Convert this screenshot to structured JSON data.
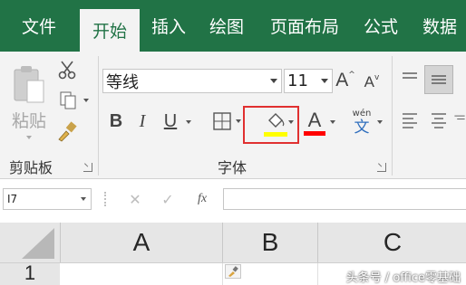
{
  "tabs": [
    {
      "label": "文件"
    },
    {
      "label": "开始",
      "active": true
    },
    {
      "label": "插入"
    },
    {
      "label": "绘图"
    },
    {
      "label": "页面布局"
    },
    {
      "label": "公式"
    },
    {
      "label": "数据"
    }
  ],
  "clipboard": {
    "paste_label": "粘贴",
    "group_label": "剪贴板"
  },
  "font": {
    "font_name": "等线",
    "font_size": "11",
    "bold_label": "B",
    "italic_label": "I",
    "underline_label": "U",
    "font_color_label": "A",
    "phonetic_top": "wén",
    "phonetic_bottom": "文",
    "group_label": "字体",
    "fill_color": "#ffff00",
    "font_color": "#ff0000"
  },
  "formula_bar": {
    "name_box": "I7",
    "fx_label": "fx"
  },
  "grid": {
    "columns": [
      "A",
      "B",
      "C"
    ],
    "rows": [
      "1"
    ]
  },
  "watermark": "头条号 / office零基础",
  "colors": {
    "ribbon_green": "#217346",
    "highlight_box": "#e03030"
  }
}
